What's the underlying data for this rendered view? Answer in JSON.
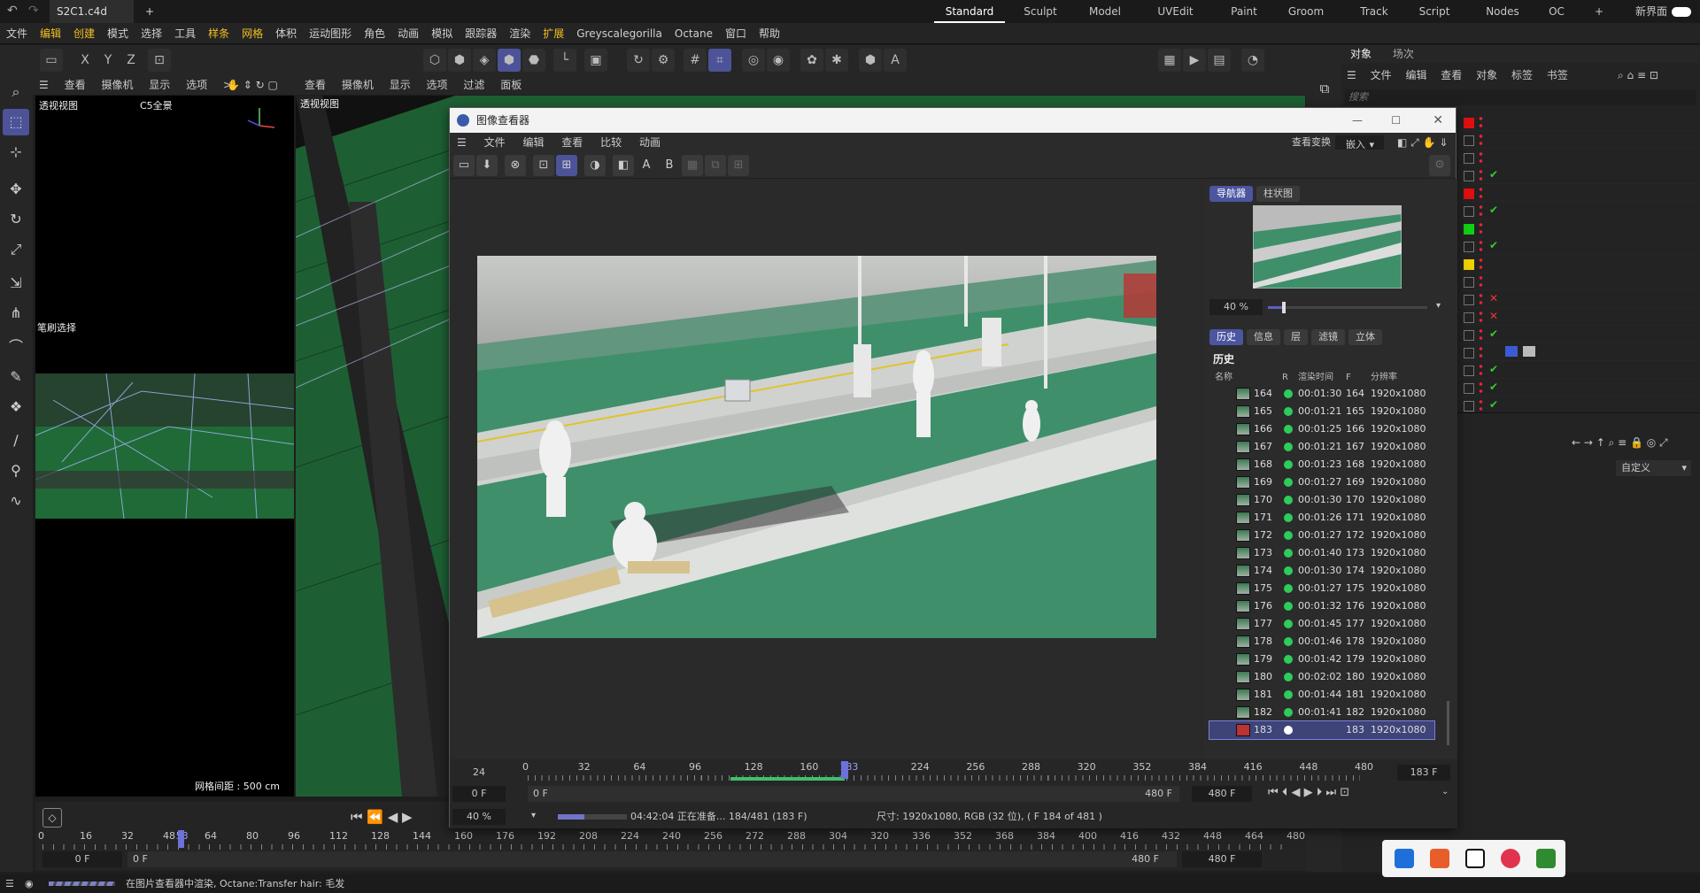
{
  "app": {
    "tab_title": "S2C1.c4d *",
    "new_tab": "+"
  },
  "workspaces": [
    "Standard",
    "Sculpt",
    "Model",
    "UVEdit",
    "Paint",
    "Groom",
    "Track",
    "Script",
    "Nodes",
    "OC",
    "+",
    "新界面"
  ],
  "menu": [
    "文件",
    "编辑",
    "创建",
    "模式",
    "选择",
    "工具",
    "样条",
    "网格",
    "体积",
    "运动图形",
    "角色",
    "动画",
    "模拟",
    "跟踪器",
    "渲染",
    "扩展",
    "Greyscalegorilla",
    "Octane",
    "窗口",
    "帮助"
  ],
  "axis_buttons": [
    "X",
    "Y",
    "Z"
  ],
  "left_viewport": {
    "menu": [
      "查看",
      "摄像机",
      "显示",
      "选项",
      ">"
    ],
    "label": "透视视图",
    "camera": "C5全景",
    "brush": "笔刷选择",
    "grid": "网格间距 : 500 cm"
  },
  "right_viewport": {
    "menu": [
      "查看",
      "摄像机",
      "显示",
      "选项",
      "过滤",
      "面板"
    ],
    "label": "透视视图"
  },
  "object_panel": {
    "tabs": [
      "对象",
      "场次"
    ],
    "menu": [
      "文件",
      "编辑",
      "查看",
      "对象",
      "标签",
      "书签"
    ],
    "search_placeholder": "搜索",
    "attr_dropdown": "自定义",
    "rows": [
      {
        "c": "#e01010",
        "chk": ""
      },
      {
        "c": "",
        "chk": ""
      },
      {
        "c": "",
        "chk": ""
      },
      {
        "c": "",
        "chk": "✔"
      },
      {
        "c": "#e01010",
        "chk": ""
      },
      {
        "c": "",
        "chk": "✔"
      },
      {
        "c": "#11d011",
        "chk": ""
      },
      {
        "c": "",
        "chk": "✔"
      },
      {
        "c": "#f0d000",
        "chk": ""
      },
      {
        "c": "",
        "chk": ""
      },
      {
        "c": "",
        "chk": "✕"
      },
      {
        "c": "",
        "chk": "✕"
      },
      {
        "c": "",
        "chk": "✔"
      },
      {
        "c": "",
        "chk": ""
      },
      {
        "c": "",
        "chk": "✔"
      },
      {
        "c": "",
        "chk": "✔"
      },
      {
        "c": "",
        "chk": "✔"
      }
    ]
  },
  "picture_viewer": {
    "title": "图像查看器",
    "menu": [
      "文件",
      "编辑",
      "查看",
      "比较",
      "动画"
    ],
    "view_transform_label": "查看变换",
    "view_transform_value": "嵌入",
    "nav_tabs": [
      "导航器",
      "柱状图"
    ],
    "zoom": "40 %",
    "info_tabs": [
      "历史",
      "信息",
      "层",
      "滤镜",
      "立体"
    ],
    "history_title": "历史",
    "history_headers": [
      "名称",
      "R",
      "渲染时间",
      "F",
      "分辨率"
    ],
    "history": [
      {
        "n": "164",
        "t": "00:01:30",
        "f": "164",
        "r": "1920x1080"
      },
      {
        "n": "165",
        "t": "00:01:21",
        "f": "165",
        "r": "1920x1080"
      },
      {
        "n": "166",
        "t": "00:01:25",
        "f": "166",
        "r": "1920x1080"
      },
      {
        "n": "167",
        "t": "00:01:21",
        "f": "167",
        "r": "1920x1080"
      },
      {
        "n": "168",
        "t": "00:01:23",
        "f": "168",
        "r": "1920x1080"
      },
      {
        "n": "169",
        "t": "00:01:27",
        "f": "169",
        "r": "1920x1080"
      },
      {
        "n": "170",
        "t": "00:01:30",
        "f": "170",
        "r": "1920x1080"
      },
      {
        "n": "171",
        "t": "00:01:26",
        "f": "171",
        "r": "1920x1080"
      },
      {
        "n": "172",
        "t": "00:01:27",
        "f": "172",
        "r": "1920x1080"
      },
      {
        "n": "173",
        "t": "00:01:40",
        "f": "173",
        "r": "1920x1080"
      },
      {
        "n": "174",
        "t": "00:01:30",
        "f": "174",
        "r": "1920x1080"
      },
      {
        "n": "175",
        "t": "00:01:27",
        "f": "175",
        "r": "1920x1080"
      },
      {
        "n": "176",
        "t": "00:01:32",
        "f": "176",
        "r": "1920x1080"
      },
      {
        "n": "177",
        "t": "00:01:45",
        "f": "177",
        "r": "1920x1080"
      },
      {
        "n": "178",
        "t": "00:01:46",
        "f": "178",
        "r": "1920x1080"
      },
      {
        "n": "179",
        "t": "00:01:42",
        "f": "179",
        "r": "1920x1080"
      },
      {
        "n": "180",
        "t": "00:02:02",
        "f": "180",
        "r": "1920x1080"
      },
      {
        "n": "181",
        "t": "00:01:44",
        "f": "181",
        "r": "1920x1080"
      },
      {
        "n": "182",
        "t": "00:01:41",
        "f": "182",
        "r": "1920x1080"
      },
      {
        "n": "183",
        "t": "",
        "f": "183",
        "r": "1920x1080"
      }
    ],
    "fps": "24",
    "ruler_ticks": [
      "0",
      "32",
      "64",
      "96",
      "128",
      "160",
      "183",
      "224",
      "256",
      "288",
      "320",
      "352",
      "384",
      "416",
      "448",
      "480"
    ],
    "current_frame": "183 F",
    "start_frame": "0 F",
    "ruler_start": "0 F",
    "ruler_end": "480 F",
    "end_frame": "480 F",
    "bottom_zoom": "40 %",
    "progress_text": "04:42:04 正在准备... 184/481 (183 F)",
    "progress_fraction": 0.38,
    "size_text": "尺寸: 1920x1080, RGB (32 位), ( F 184 of 481 )"
  },
  "timeline": {
    "ticks": [
      "0",
      "16",
      "32",
      "48",
      "53",
      "64",
      "80",
      "96",
      "112",
      "128",
      "144",
      "160",
      "176",
      "192",
      "208",
      "224",
      "240",
      "256",
      "272",
      "288",
      "304",
      "320",
      "336",
      "352",
      "368",
      "384",
      "400",
      "416",
      "432",
      "448",
      "464",
      "480"
    ],
    "start": "0 F",
    "start2": "0 F",
    "end": "480 F",
    "end2": "480 F"
  },
  "status": {
    "text": "在图片查看器中渲染, Octane:Transfer hair: 毛发"
  }
}
